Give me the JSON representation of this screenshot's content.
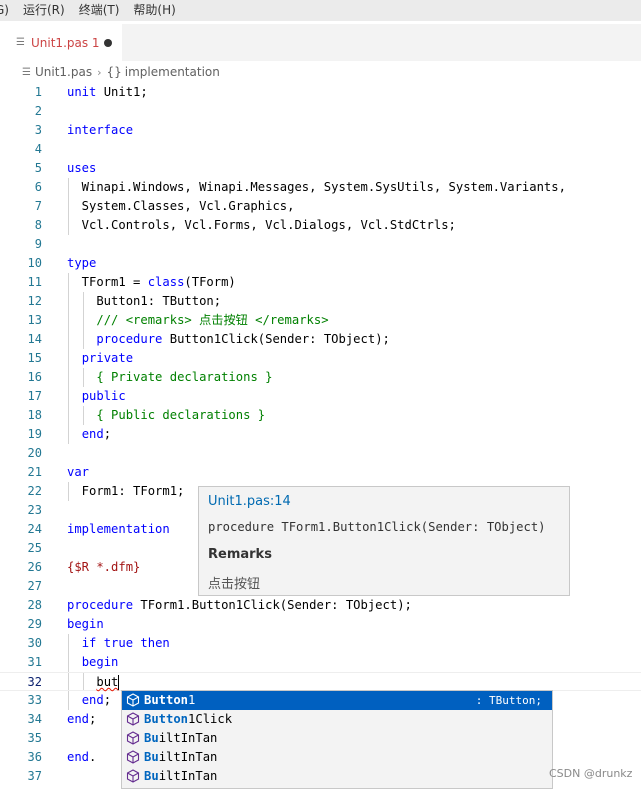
{
  "menubar": {
    "items": [
      "G)",
      "运行(R)",
      "终端(T)",
      "帮助(H)"
    ]
  },
  "tab": {
    "title": "Unit1.pas 1",
    "modified": true
  },
  "breadcrumb": {
    "file": "Unit1.pas",
    "symbol": "implementation",
    "symbol_icon": "{}"
  },
  "editor": {
    "lines": [
      {
        "n": "1"
      },
      {
        "n": "2"
      },
      {
        "n": "3"
      },
      {
        "n": "4"
      },
      {
        "n": "5"
      },
      {
        "n": "6"
      },
      {
        "n": "7"
      },
      {
        "n": "8"
      },
      {
        "n": "9"
      },
      {
        "n": "10"
      },
      {
        "n": "11"
      },
      {
        "n": "12"
      },
      {
        "n": "13"
      },
      {
        "n": "14"
      },
      {
        "n": "15"
      },
      {
        "n": "16"
      },
      {
        "n": "17"
      },
      {
        "n": "18"
      },
      {
        "n": "19"
      },
      {
        "n": "20"
      },
      {
        "n": "21"
      },
      {
        "n": "22"
      },
      {
        "n": "23"
      },
      {
        "n": "24"
      },
      {
        "n": "25"
      },
      {
        "n": "26"
      },
      {
        "n": "27"
      },
      {
        "n": "28"
      },
      {
        "n": "29"
      },
      {
        "n": "30"
      },
      {
        "n": "31"
      },
      {
        "n": "32"
      },
      {
        "n": "33"
      },
      {
        "n": "34"
      },
      {
        "n": "35"
      },
      {
        "n": "36"
      },
      {
        "n": "37"
      }
    ],
    "code": {
      "l1_kw": "unit",
      "l1_rest": " Unit1;",
      "l3_kw": "interface",
      "l5_kw": "uses",
      "l6": "  Winapi.Windows, Winapi.Messages, System.SysUtils, System.Variants,",
      "l7": "  System.Classes, Vcl.Graphics,",
      "l8": "  Vcl.Controls, Vcl.Forms, Vcl.Dialogs, Vcl.StdCtrls;",
      "l10_kw": "type",
      "l11_a": "  TForm1 = ",
      "l11_kw": "class",
      "l11_b": "(TForm)",
      "l12": "    Button1: TButton;",
      "l13_indent": "    ",
      "l13_cm": "/// <remarks> 点击按钮 </remarks>",
      "l14_indent": "    ",
      "l14_kw": "procedure",
      "l14_rest": " Button1Click(Sender: TObject);",
      "l15_indent": "  ",
      "l15_kw": "private",
      "l16_indent": "    ",
      "l16_cm": "{ Private declarations }",
      "l17_indent": "  ",
      "l17_kw": "public",
      "l18_indent": "    ",
      "l18_cm": "{ Public declarations }",
      "l19_indent": "  ",
      "l19_kw": "end",
      "l19_rest": ";",
      "l21_kw": "var",
      "l22": "  Form1: TForm1;",
      "l24_kw": "implementation",
      "l26_dir": "{$R *.dfm}",
      "l28_kw": "procedure",
      "l28_rest": " TForm1.Button1Click(Sender: TObject);",
      "l29_kw": "begin",
      "l30_indent": "  ",
      "l30_kw1": "if",
      "l30_sp": " ",
      "l30_kw2": "true",
      "l30_sp2": " ",
      "l30_kw3": "then",
      "l31_indent": "  ",
      "l31_kw": "begin",
      "l32_indent": "    ",
      "l32_typed": "but",
      "l33_indent": "  ",
      "l33_kw": "end",
      "l33_rest": ";",
      "l34_kw": "end",
      "l34_rest": ";",
      "l36_kw": "end",
      "l36_rest": "."
    }
  },
  "hover": {
    "file": "Unit1.pas:14",
    "signature": "procedure TForm1.Button1Click(Sender: TObject)",
    "heading": "Remarks",
    "description": "点击按钮"
  },
  "suggest": {
    "items": [
      {
        "match": "Button",
        "rest": "1",
        "detail": ": TButton;",
        "icon": "cube-icon",
        "selected": true
      },
      {
        "match": "Button",
        "rest": "1Click",
        "detail": "",
        "icon": "cube-icon",
        "selected": false
      },
      {
        "match": "Bu",
        "rest": "iltInTan",
        "detail": "",
        "icon": "cube-icon",
        "selected": false
      },
      {
        "match": "Bu",
        "rest": "iltInTan",
        "detail": "",
        "icon": "cube-icon",
        "selected": false
      },
      {
        "match": "Bu",
        "rest": "iltInTan",
        "detail": "",
        "icon": "cube-icon",
        "selected": false
      }
    ]
  },
  "watermark": "CSDN @drunkz",
  "colors": {
    "keyword": "#0000ff",
    "comment": "#008000",
    "line_number": "#237893",
    "selection": "#0060c0",
    "tab_title": "#cc4444"
  }
}
